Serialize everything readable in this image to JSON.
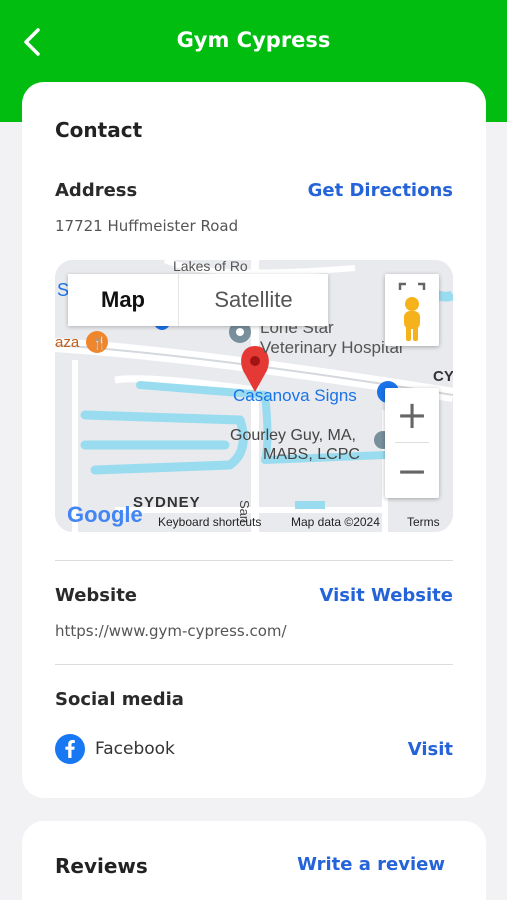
{
  "header": {
    "title": "Gym Cypress"
  },
  "contact": {
    "title": "Contact",
    "address_label": "Address",
    "directions_link": "Get Directions",
    "address_value": "17721 Huffmeister Road",
    "map": {
      "map_tab": "Map",
      "satellite_tab": "Satellite",
      "zoom_in": "+",
      "zoom_out": "−",
      "labels": {
        "lakes": "Lakes of Ro",
        "lone_star_1": "Lone Star",
        "lone_star_2": "Veterinary Hospital",
        "casanova": "Casanova Signs",
        "gourley_1": "Gourley Guy, MA,",
        "gourley_2": "MABS, LCPC",
        "sydney": "SYDNEY",
        "san": "San",
        "cy": "CY",
        "aza": "aza",
        "s_left": "S"
      },
      "attribution": {
        "google": "Google",
        "shortcuts": "Keyboard shortcuts",
        "map_data": "Map data ©2024",
        "terms": "Terms"
      },
      "colors": {
        "water": "#9adcef",
        "road": "#ffffff",
        "pin": "#e53935",
        "restaurant": "#f0862c",
        "poi_blue": "#1a73e8",
        "poi_gray": "#78909c"
      }
    },
    "website_label": "Website",
    "website_link": "Visit Website",
    "website_value": "https://www.gym-cypress.com/",
    "social_label": "Social media",
    "social_items": [
      {
        "icon": "facebook-icon",
        "name": "Facebook",
        "action": "Visit"
      }
    ]
  },
  "reviews": {
    "title": "Reviews",
    "write_link": "Write a review"
  },
  "colors": {
    "header_bg": "#00bd10",
    "link": "#2563d8",
    "facebook": "#1877f2"
  }
}
